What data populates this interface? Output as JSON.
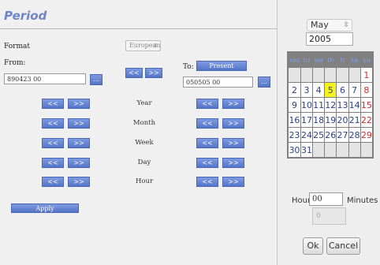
{
  "title": "Period",
  "format": {
    "label": "Format",
    "value": "European"
  },
  "from": {
    "label": "From:",
    "value": "890423 00",
    "picker_label": "..."
  },
  "to": {
    "label": "To:",
    "present_label": "Present",
    "value": "050505 00",
    "picker_label": "..."
  },
  "nav": {
    "back": "<<",
    "fwd": ">>"
  },
  "rows": [
    "Year",
    "Month",
    "Week",
    "Day",
    "Hour"
  ],
  "apply_label": "Apply",
  "calendar": {
    "month": "May",
    "year": "2005",
    "weekdays": [
      "mo",
      "tu",
      "we",
      "th",
      "fr",
      "sa",
      "su"
    ],
    "weeks": [
      [
        "",
        "",
        "",
        "",
        "",
        "",
        "1"
      ],
      [
        "2",
        "3",
        "4",
        "5",
        "6",
        "7",
        "8"
      ],
      [
        "9",
        "10",
        "11",
        "12",
        "13",
        "14",
        "15"
      ],
      [
        "16",
        "17",
        "18",
        "19",
        "20",
        "21",
        "22"
      ],
      [
        "23",
        "24",
        "25",
        "26",
        "27",
        "28",
        "29"
      ],
      [
        "30",
        "31",
        "",
        "",
        "",
        "",
        ""
      ]
    ],
    "selected_day": "5"
  },
  "time": {
    "hour_label": "Hour",
    "hour_value": "00",
    "minutes_label": "Minutes",
    "minutes_value": "0"
  },
  "ok_label": "Ok",
  "cancel_label": "Cancel",
  "colors": {
    "button_blue": "#5a7bd0",
    "accent_title": "#6f84c8",
    "selected_day": "#f5f21d",
    "sunday": "#d92a2a"
  }
}
